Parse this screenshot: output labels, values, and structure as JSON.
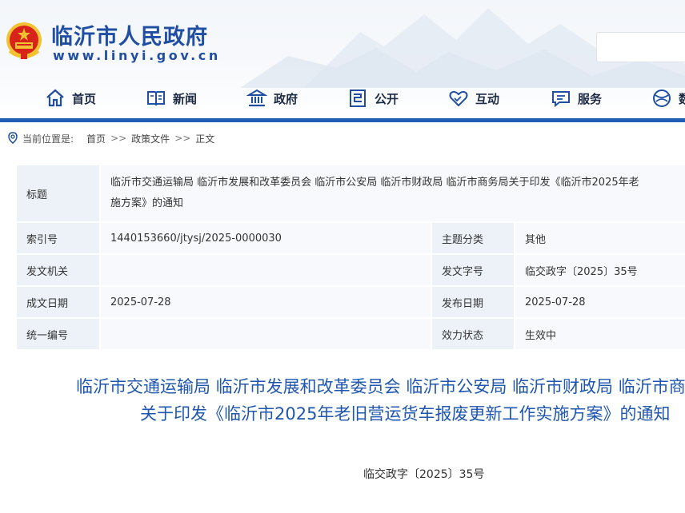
{
  "site": {
    "title": "临沂市人民政府",
    "url": "www.linyi.gov.cn"
  },
  "nav": {
    "items": [
      {
        "label": "首页",
        "icon": "home-icon"
      },
      {
        "label": "新闻",
        "icon": "news-book-icon"
      },
      {
        "label": "政府",
        "icon": "government-building-icon"
      },
      {
        "label": "公开",
        "icon": "disclosure-doc-icon"
      },
      {
        "label": "互动",
        "icon": "handshake-heart-icon"
      },
      {
        "label": "服务",
        "icon": "service-chat-icon"
      },
      {
        "label": "数",
        "icon": "data-globe-icon"
      }
    ]
  },
  "breadcrumb": {
    "prefix": "当前位置是:",
    "items": [
      "首页",
      "政策文件",
      "正文"
    ],
    "separator": ">>"
  },
  "meta": {
    "title_label": "标题",
    "title_value": "临沂市交通运输局 临沂市发展和改革委员会 临沂市公安局 临沂市财政局 临沂市商务局关于印发《临沂市2025年老旧营运货车报废更新工作实施方案》的通知",
    "title_value_line1": "临沂市交通运输局 临沂市发展和改革委员会 临沂市公安局 临沂市财政局 临沂市商务局关于印发《临沂市2025年老",
    "title_value_line2": "施方案》的通知",
    "rows": [
      {
        "label1": "索引号",
        "value1": "1440153660/jtysj/2025-0000030",
        "label2": "主题分类",
        "value2": "其他"
      },
      {
        "label1": "发文机关",
        "value1": "",
        "label2": "发文字号",
        "value2": "临交政字〔2025〕35号"
      },
      {
        "label1": "成文日期",
        "value1": "2025-07-28",
        "label2": "发布日期",
        "value2": "2025-07-28"
      },
      {
        "label1": "统一编号",
        "value1": "",
        "label2": "效力状态",
        "value2": "生效中"
      }
    ]
  },
  "article": {
    "title_line1": "临沂市交通运输局 临沂市发展和改革委员会 临沂市公安局 临沂市财政局 临沂市商务局",
    "title_line2": "关于印发《临沂市2025年老旧营运货车报废更新工作实施方案》的通知",
    "doc_number": "临交政字〔2025〕35号"
  },
  "colors": {
    "brand_blue": "#1f4ea3",
    "nav_bar": "#1f5cb4",
    "label_bg": "#edf2f8",
    "value_bg": "#f7f9fc",
    "emblem_red": "#d8231a",
    "emblem_gold": "#f2c230"
  }
}
